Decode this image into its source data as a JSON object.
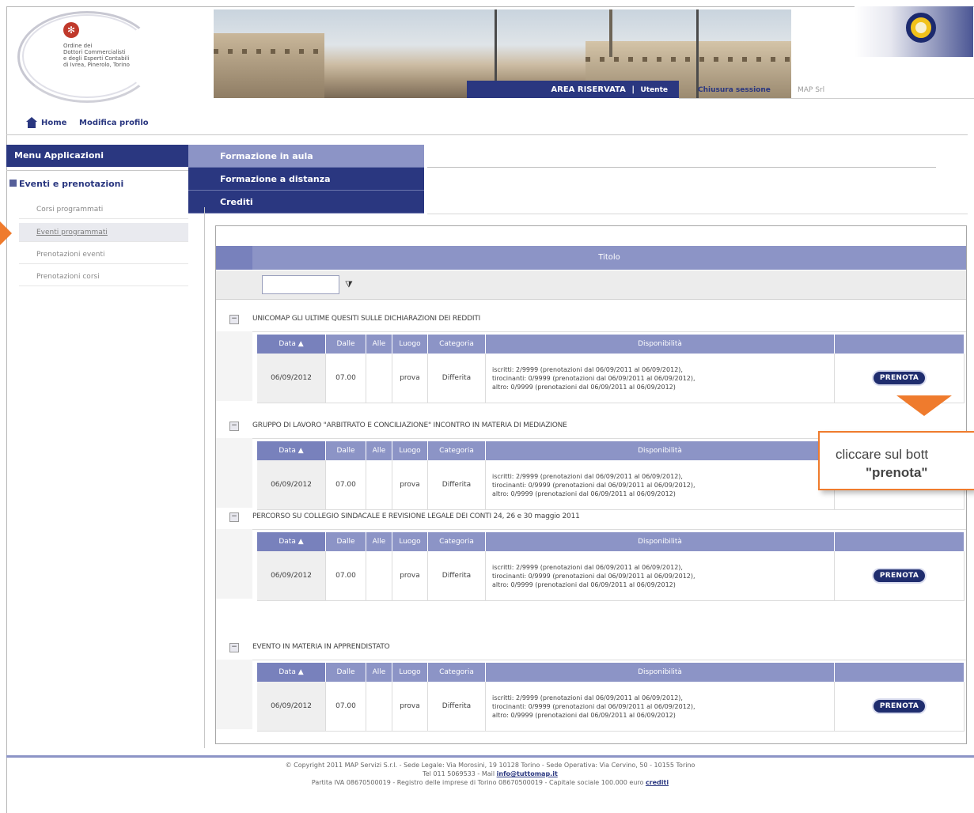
{
  "header": {
    "logo_lines": [
      "Ordine dei",
      "Dottori Commercialisti",
      "e degli Esperti Contabili",
      "di Ivrea, Pinerolo, Torino"
    ],
    "area_label": "AREA RISERVATA",
    "separator": "|",
    "user_label": "Utente",
    "logout_label": "Chiusura sessione",
    "company_name": "MAP Srl"
  },
  "topnav": {
    "home": "Home",
    "profile": "Modifica profilo"
  },
  "sidebar": {
    "title": "Menu Applicazioni",
    "group": "Eventi e prenotazioni",
    "items": [
      {
        "label": "Corsi programmati"
      },
      {
        "label": "Eventi programmati"
      },
      {
        "label": "Prenotazioni eventi"
      },
      {
        "label": "Prenotazioni corsi"
      }
    ]
  },
  "flyout": {
    "items": [
      "Formazione in aula",
      "Formazione a distanza",
      "Crediti"
    ]
  },
  "grid": {
    "column_title": "Titolo",
    "filter_icon": "funnel-icon",
    "subheaders": {
      "date": "Data",
      "sort": "▲",
      "from": "Dalle",
      "to": "Alle",
      "place": "Luogo",
      "category": "Categoria",
      "availability": "Disponibilità"
    },
    "events": [
      {
        "title": "UNICOMAP GLI ULTIME QUESITI SULLE DICHIARAZIONI DEI REDDITI",
        "date": "06/09/2012",
        "from": "07.00",
        "to": "",
        "place": "prova",
        "category": "Differita",
        "availability": [
          "iscritti: 2/9999 (prenotazioni dal 06/09/2011 al 06/09/2012),",
          "tirocinanti: 0/9999 (prenotazioni dal 06/09/2011 al 06/09/2012),",
          "altro: 0/9999 (prenotazioni dal 06/09/2011 al 06/09/2012)"
        ],
        "button": "PRENOTA"
      },
      {
        "title": "GRUPPO DI LAVORO \"ARBITRATO E CONCILIAZIONE\" INCONTRO IN MATERIA DI MEDIAZIONE",
        "date": "06/09/2012",
        "from": "07.00",
        "to": "",
        "place": "prova",
        "category": "Differita",
        "availability": [
          "iscritti: 2/9999 (prenotazioni dal 06/09/2011 al 06/09/2012),",
          "tirocinanti: 0/9999 (prenotazioni dal 06/09/2011 al 06/09/2012),",
          "altro: 0/9999 (prenotazioni dal 06/09/2011 al 06/09/2012)"
        ],
        "button": ""
      },
      {
        "title": "PERCORSO SU COLLEGIO SINDACALE E REVISIONE LEGALE DEI CONTI 24, 26 e 30 maggio 2011",
        "date": "06/09/2012",
        "from": "07.00",
        "to": "",
        "place": "prova",
        "category": "Differita",
        "availability": [
          "iscritti: 2/9999 (prenotazioni dal 06/09/2011 al 06/09/2012),",
          "tirocinanti: 0/9999 (prenotazioni dal 06/09/2011 al 06/09/2012),",
          "altro: 0/9999 (prenotazioni dal 06/09/2011 al 06/09/2012)"
        ],
        "button": "PRENOTA"
      },
      {
        "title": "EVENTO IN MATERIA IN APPRENDISTATO",
        "date": "06/09/2012",
        "from": "07.00",
        "to": "",
        "place": "prova",
        "category": "Differita",
        "availability": [
          "iscritti: 2/9999 (prenotazioni dal 06/09/2011 al 06/09/2012),",
          "tirocinanti: 0/9999 (prenotazioni dal 06/09/2011 al 06/09/2012),",
          "altro: 0/9999 (prenotazioni dal 06/09/2011 al 06/09/2012)"
        ],
        "button": "PRENOTA"
      }
    ]
  },
  "callout": {
    "line1": "cliccare sul bott",
    "line2": "\"prenota\""
  },
  "footer": {
    "line1": "© Copyright 2011 MAP Servizi S.r.l. - Sede Legale: Via Morosini, 19 10128 Torino - Sede Operativa: Via Cervino, 50 - 10155 Torino",
    "line2_prefix": "Tel 011 5069533 - Mail ",
    "email": "info@tuttomap.it",
    "line3_prefix": "Partita IVA 08670500019 - Registro delle imprese di Torino 08670500019 - Capitale sociale 100.000 euro ",
    "credits": "crediti"
  },
  "colors": {
    "brand_navy": "#2a3780",
    "header_lilac": "#8c94c6",
    "accent_orange": "#ef7b2d"
  }
}
